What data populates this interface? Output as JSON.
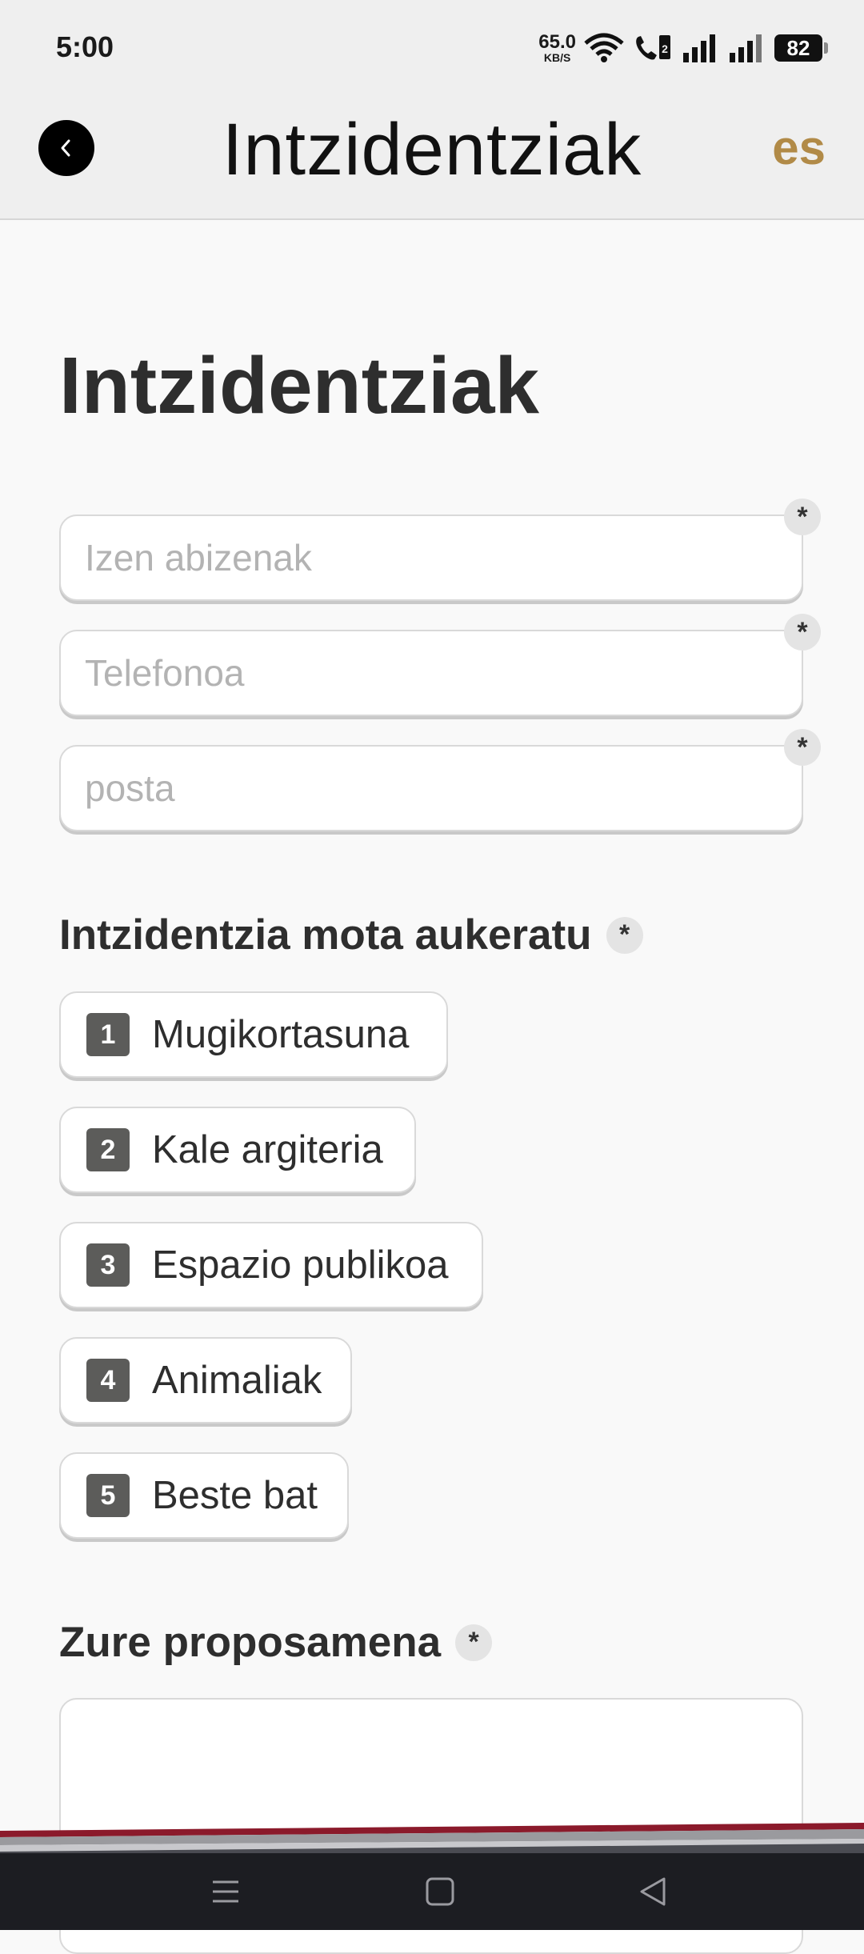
{
  "status_bar": {
    "time": "5:00",
    "net_speed_value": "65.0",
    "net_speed_unit": "KB/S",
    "battery": "82",
    "icons": [
      "wifi-icon",
      "volte-call-icon",
      "signal-icon",
      "signal-icon"
    ]
  },
  "app_bar": {
    "title": "Intzidentziak",
    "language": "es",
    "back_icon": "chevron-left-icon"
  },
  "page": {
    "title": "Intzidentziak"
  },
  "form": {
    "required_mark": "*",
    "name_placeholder": "Izen abizenak",
    "phone_placeholder": "Telefonoa",
    "email_placeholder": "posta",
    "type_label": "Intzidentzia mota aukeratu",
    "options": [
      {
        "num": "1",
        "label": "Mugikortasuna"
      },
      {
        "num": "2",
        "label": "Kale argiteria"
      },
      {
        "num": "3",
        "label": "Espazio publikoa"
      },
      {
        "num": "4",
        "label": "Animaliak"
      },
      {
        "num": "5",
        "label": "Beste bat"
      }
    ],
    "proposal_label": "Zure proposamena"
  },
  "colors": {
    "accent": "#b18a47",
    "stripe_red": "#8b1a2b",
    "navbar": "#1c1d22"
  },
  "nav_bar": {
    "icons": [
      "menu-icon",
      "home-icon",
      "back-icon"
    ]
  }
}
